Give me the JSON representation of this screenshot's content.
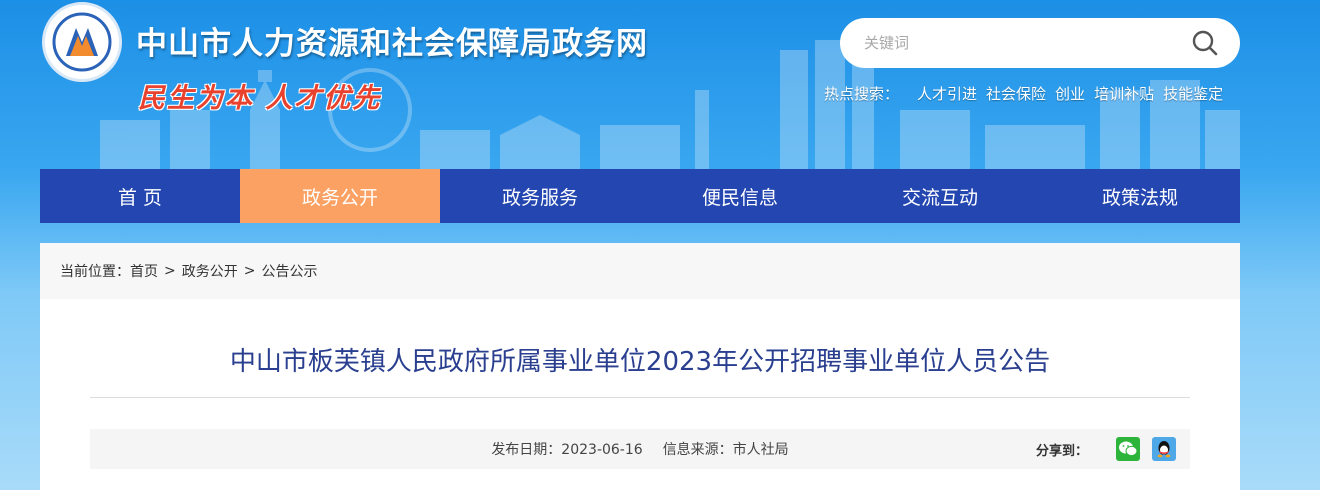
{
  "header": {
    "site_title": "中山市人力资源和社会保障局政务网",
    "slogan": "民生为本 人才优先",
    "search": {
      "placeholder": "关键词"
    },
    "hot_search": {
      "label": "热点搜索：",
      "links": [
        "人才引进",
        "社会保险",
        "创业",
        "培训补贴",
        "技能鉴定"
      ]
    }
  },
  "nav": {
    "items": [
      "首 页",
      "政务公开",
      "政务服务",
      "便民信息",
      "交流互动",
      "政策法规"
    ],
    "active_index": 1
  },
  "breadcrumb": {
    "prefix": "当前位置：",
    "items": [
      "首页",
      "政务公开",
      "公告公示"
    ],
    "separator": ">"
  },
  "article": {
    "title": "中山市板芙镇人民政府所属事业单位2023年公开招聘事业单位人员公告",
    "publish_date": "发布日期：2023-06-16",
    "source": "信息来源：市人社局",
    "share_label": "分享到："
  },
  "colors": {
    "nav_bg": "#2346b0",
    "nav_active": "#fba163",
    "title_color": "#2a3f8f"
  }
}
